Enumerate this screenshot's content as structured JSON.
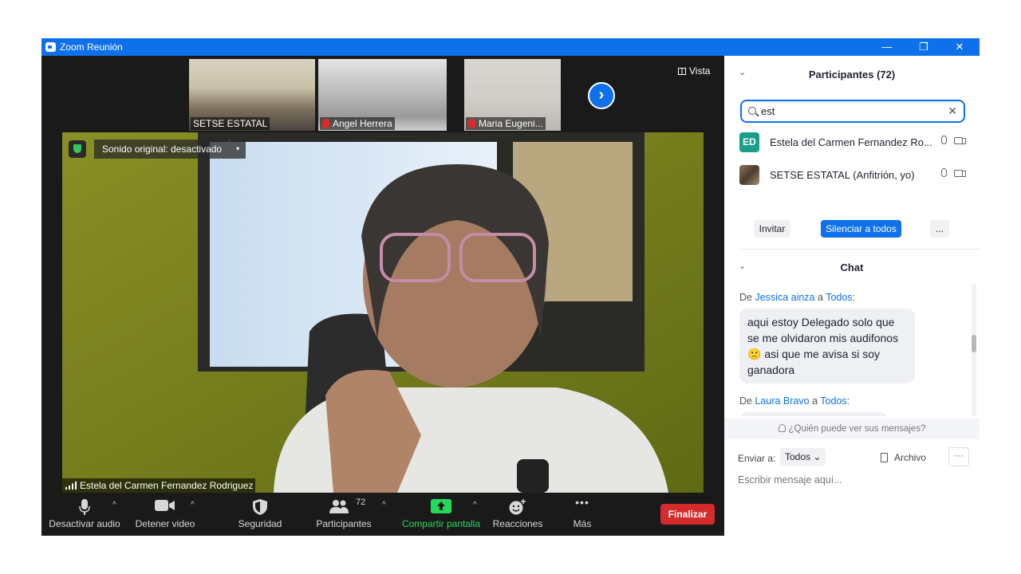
{
  "window": {
    "title": "Zoom Reunión",
    "minimize_glyph": "—",
    "restore_glyph": "❐",
    "close_glyph": "✕"
  },
  "gallery": {
    "thumbnails": [
      {
        "label": "SETSE ESTATAL",
        "muted": false
      },
      {
        "label": "Angel Herrera",
        "muted": true
      },
      {
        "label": "Maria Eugeni...",
        "muted": true
      }
    ],
    "next_glyph": "›",
    "view_label": "Vista"
  },
  "main_video": {
    "audio_menu_label": "Sonido original: desactivado",
    "audio_menu_caret": "▾",
    "speaker_name": "Estela del Carmen Fernandez Rodriguez"
  },
  "toolbar": {
    "caret_glyph": "^",
    "mute_label": "Desactivar audio",
    "video_label": "Detener video",
    "security_label": "Seguridad",
    "participants_label": "Participantes",
    "participants_count": "72",
    "share_label": "Compartir pantalla",
    "reactions_label": "Reacciones",
    "more_label": "Más",
    "more_glyph": "•••",
    "end_label": "Finalizar"
  },
  "participants_panel": {
    "collapse_glyph": "⌄",
    "title": "Participantes (72)",
    "search_value": "est",
    "clear_glyph": "✕",
    "list": [
      {
        "initials": "ED",
        "name": "Estela del Carmen Fernandez Ro...",
        "avatar_color": "#1aa08a"
      },
      {
        "initials": "",
        "name": "SETSE ESTATAL (Anfitrión, yo)",
        "avatar_color": "#6b5a44"
      }
    ],
    "invite_label": "Invitar",
    "mute_all_label": "Silenciar a todos",
    "more_label": "..."
  },
  "chat_panel": {
    "title": "Chat",
    "messages": [
      {
        "from": "Jessica ainza",
        "connector": "a",
        "to": "Todos",
        "suffix": ":",
        "text": "aqui estoy Delegado solo que se me olvidaron mis audifonos 🙁 asi que me avisa si soy ganadora"
      },
      {
        "from": "Laura Bravo",
        "connector": "a",
        "to": "Todos",
        "suffix": ":",
        "text": ""
      }
    ],
    "from_prefix": "De",
    "who_can_see": "¿Quién puede ver sus mensajes?",
    "send_to_label": "Enviar a:",
    "send_to_value": "Todos",
    "send_to_caret": "⌄",
    "file_label": "Archivo",
    "more_glyph": "···",
    "compose_placeholder": "Escribir mensaje aquí..."
  },
  "colors": {
    "accent": "#0e71eb",
    "end_button": "#d42b2b",
    "share_green": "#23d959",
    "toolbar_bg": "#1a1a1a"
  }
}
